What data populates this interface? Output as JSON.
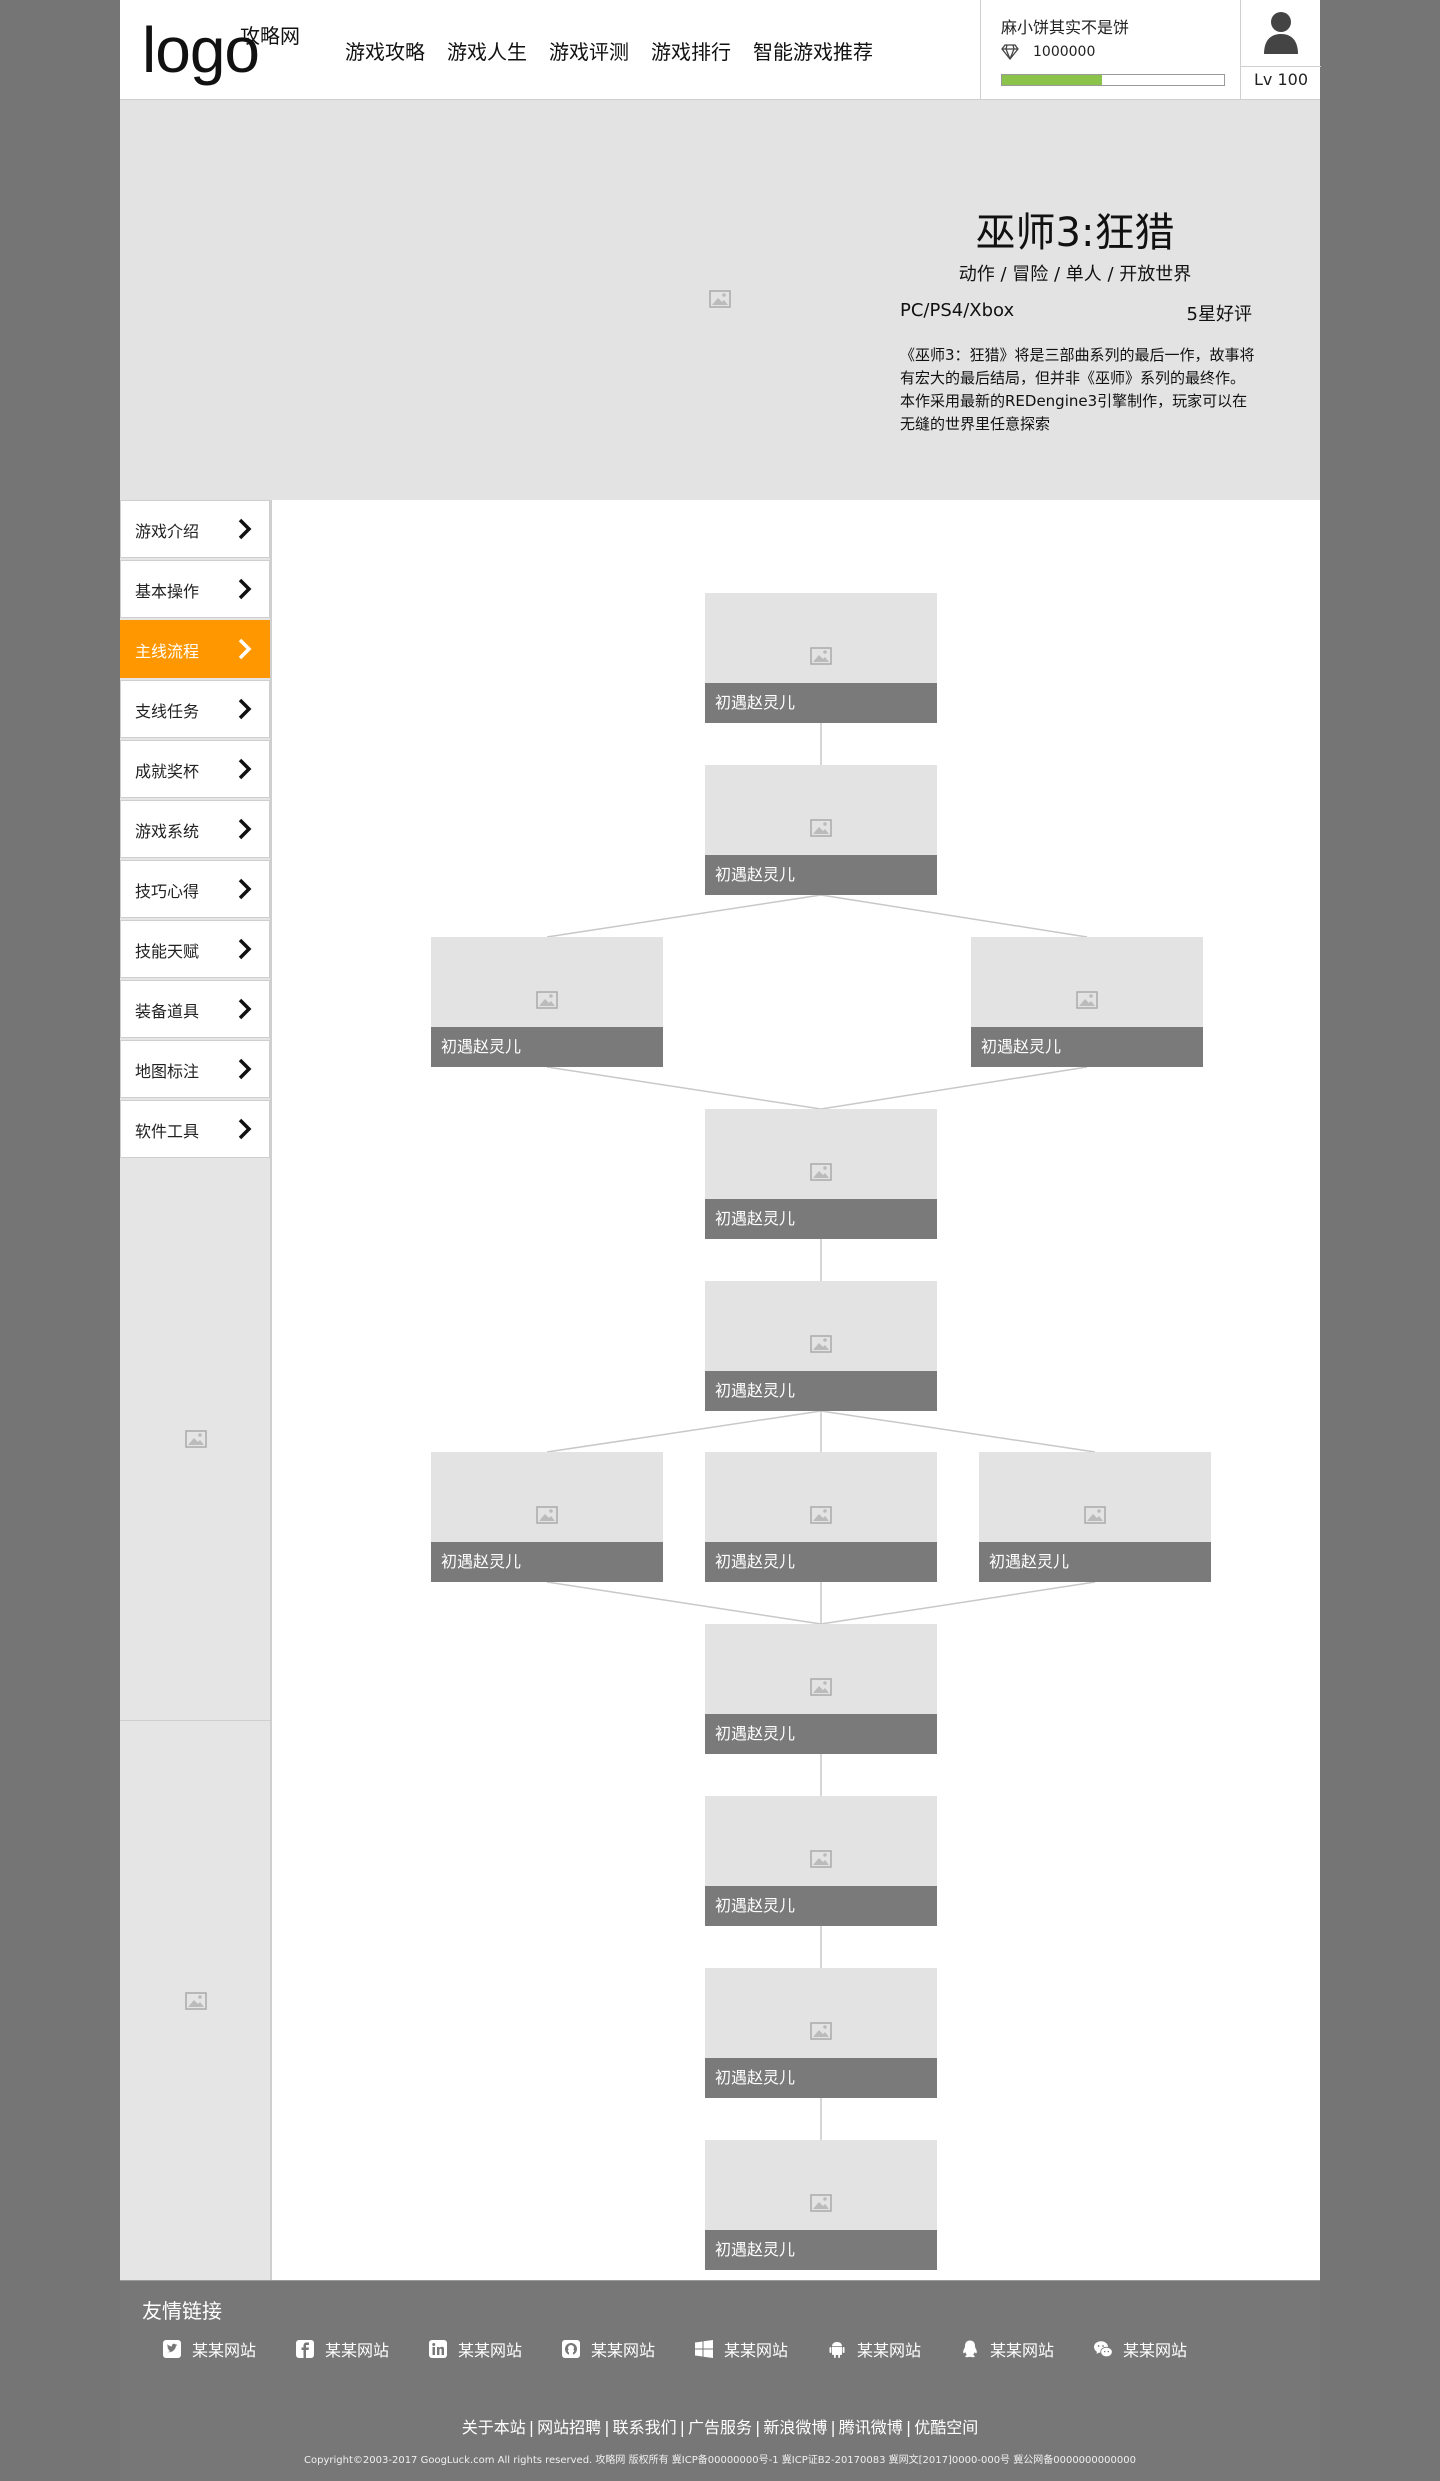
{
  "header": {
    "logo_main": "logo",
    "logo_sub": "攻略网",
    "nav": [
      "游戏攻略",
      "游戏人生",
      "游戏评测",
      "游戏排行",
      "智能游戏推荐"
    ],
    "user": {
      "name": "麻小饼其实不是饼",
      "coins": "1000000",
      "level": "Lv 100",
      "xp_progress": 0.45,
      "xp_color": "#8bc34a"
    }
  },
  "banner": {
    "title": "巫师3:狂猎",
    "genres": "动作 / 冒险 / 单人 / 开放世界",
    "platform": "PC/PS4/Xbox",
    "rating": "5星好评",
    "description": "《巫师3：狂猎》将是三部曲系列的最后一作，故事将有宏大的最后结局，但并非《巫师》系列的最终作。本作采用最新的REDengine3引擎制作，玩家可以在无缝的世界里任意探索"
  },
  "sidebar": {
    "items": [
      "游戏介绍",
      "基本操作",
      "主线流程",
      "支线任务",
      "成就奖杯",
      "游戏系统",
      "技巧心得",
      "技能天赋",
      "装备道具",
      "地图标注",
      "软件工具"
    ],
    "active_index": 2,
    "active_color": "#ff9800"
  },
  "flow": {
    "node_label": "初遇赵灵儿",
    "nodes": [
      "初遇赵灵儿",
      "初遇赵灵儿",
      "初遇赵灵儿",
      "初遇赵灵儿",
      "初遇赵灵儿",
      "初遇赵灵儿",
      "初遇赵灵儿",
      "初遇赵灵儿",
      "初遇赵灵儿",
      "初遇赵灵儿",
      "初遇赵灵儿",
      "初遇赵灵儿",
      "初遇赵灵儿"
    ]
  },
  "footer": {
    "links_title": "友情链接",
    "links": [
      {
        "icon": "twitter-icon",
        "label": "某某网站"
      },
      {
        "icon": "facebook-icon",
        "label": "某某网站"
      },
      {
        "icon": "linkedin-icon",
        "label": "某某网站"
      },
      {
        "icon": "github-icon",
        "label": "某某网站"
      },
      {
        "icon": "windows-icon",
        "label": "某某网站"
      },
      {
        "icon": "android-icon",
        "label": "某某网站"
      },
      {
        "icon": "qq-icon",
        "label": "某某网站"
      },
      {
        "icon": "wechat-icon",
        "label": "某某网站"
      }
    ],
    "about_links": [
      "关于本站",
      "网站招聘",
      "联系我们",
      "广告服务",
      "新浪微博",
      "腾讯微博",
      "优酷空间"
    ],
    "copyright": "Copyright©2003-2017 GoogLuck.com All rights reserved. 攻略网 版权所有 冀ICP备00000000号-1 冀ICP证B2-20170083 冀网文[2017]0000-000号 冀公网备0000000000000"
  }
}
